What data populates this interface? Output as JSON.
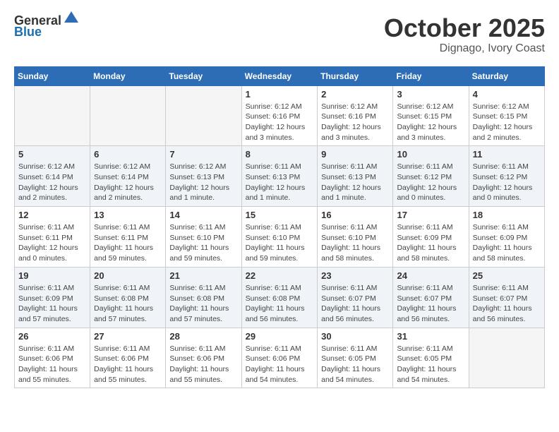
{
  "logo": {
    "general": "General",
    "blue": "Blue"
  },
  "title": "October 2025",
  "location": "Dignago, Ivory Coast",
  "weekdays": [
    "Sunday",
    "Monday",
    "Tuesday",
    "Wednesday",
    "Thursday",
    "Friday",
    "Saturday"
  ],
  "weeks": [
    [
      {
        "day": "",
        "info": ""
      },
      {
        "day": "",
        "info": ""
      },
      {
        "day": "",
        "info": ""
      },
      {
        "day": "1",
        "info": "Sunrise: 6:12 AM\nSunset: 6:16 PM\nDaylight: 12 hours\nand 3 minutes."
      },
      {
        "day": "2",
        "info": "Sunrise: 6:12 AM\nSunset: 6:16 PM\nDaylight: 12 hours\nand 3 minutes."
      },
      {
        "day": "3",
        "info": "Sunrise: 6:12 AM\nSunset: 6:15 PM\nDaylight: 12 hours\nand 3 minutes."
      },
      {
        "day": "4",
        "info": "Sunrise: 6:12 AM\nSunset: 6:15 PM\nDaylight: 12 hours\nand 2 minutes."
      }
    ],
    [
      {
        "day": "5",
        "info": "Sunrise: 6:12 AM\nSunset: 6:14 PM\nDaylight: 12 hours\nand 2 minutes."
      },
      {
        "day": "6",
        "info": "Sunrise: 6:12 AM\nSunset: 6:14 PM\nDaylight: 12 hours\nand 2 minutes."
      },
      {
        "day": "7",
        "info": "Sunrise: 6:12 AM\nSunset: 6:13 PM\nDaylight: 12 hours\nand 1 minute."
      },
      {
        "day": "8",
        "info": "Sunrise: 6:11 AM\nSunset: 6:13 PM\nDaylight: 12 hours\nand 1 minute."
      },
      {
        "day": "9",
        "info": "Sunrise: 6:11 AM\nSunset: 6:13 PM\nDaylight: 12 hours\nand 1 minute."
      },
      {
        "day": "10",
        "info": "Sunrise: 6:11 AM\nSunset: 6:12 PM\nDaylight: 12 hours\nand 0 minutes."
      },
      {
        "day": "11",
        "info": "Sunrise: 6:11 AM\nSunset: 6:12 PM\nDaylight: 12 hours\nand 0 minutes."
      }
    ],
    [
      {
        "day": "12",
        "info": "Sunrise: 6:11 AM\nSunset: 6:11 PM\nDaylight: 12 hours\nand 0 minutes."
      },
      {
        "day": "13",
        "info": "Sunrise: 6:11 AM\nSunset: 6:11 PM\nDaylight: 11 hours\nand 59 minutes."
      },
      {
        "day": "14",
        "info": "Sunrise: 6:11 AM\nSunset: 6:10 PM\nDaylight: 11 hours\nand 59 minutes."
      },
      {
        "day": "15",
        "info": "Sunrise: 6:11 AM\nSunset: 6:10 PM\nDaylight: 11 hours\nand 59 minutes."
      },
      {
        "day": "16",
        "info": "Sunrise: 6:11 AM\nSunset: 6:10 PM\nDaylight: 11 hours\nand 58 minutes."
      },
      {
        "day": "17",
        "info": "Sunrise: 6:11 AM\nSunset: 6:09 PM\nDaylight: 11 hours\nand 58 minutes."
      },
      {
        "day": "18",
        "info": "Sunrise: 6:11 AM\nSunset: 6:09 PM\nDaylight: 11 hours\nand 58 minutes."
      }
    ],
    [
      {
        "day": "19",
        "info": "Sunrise: 6:11 AM\nSunset: 6:09 PM\nDaylight: 11 hours\nand 57 minutes."
      },
      {
        "day": "20",
        "info": "Sunrise: 6:11 AM\nSunset: 6:08 PM\nDaylight: 11 hours\nand 57 minutes."
      },
      {
        "day": "21",
        "info": "Sunrise: 6:11 AM\nSunset: 6:08 PM\nDaylight: 11 hours\nand 57 minutes."
      },
      {
        "day": "22",
        "info": "Sunrise: 6:11 AM\nSunset: 6:08 PM\nDaylight: 11 hours\nand 56 minutes."
      },
      {
        "day": "23",
        "info": "Sunrise: 6:11 AM\nSunset: 6:07 PM\nDaylight: 11 hours\nand 56 minutes."
      },
      {
        "day": "24",
        "info": "Sunrise: 6:11 AM\nSunset: 6:07 PM\nDaylight: 11 hours\nand 56 minutes."
      },
      {
        "day": "25",
        "info": "Sunrise: 6:11 AM\nSunset: 6:07 PM\nDaylight: 11 hours\nand 56 minutes."
      }
    ],
    [
      {
        "day": "26",
        "info": "Sunrise: 6:11 AM\nSunset: 6:06 PM\nDaylight: 11 hours\nand 55 minutes."
      },
      {
        "day": "27",
        "info": "Sunrise: 6:11 AM\nSunset: 6:06 PM\nDaylight: 11 hours\nand 55 minutes."
      },
      {
        "day": "28",
        "info": "Sunrise: 6:11 AM\nSunset: 6:06 PM\nDaylight: 11 hours\nand 55 minutes."
      },
      {
        "day": "29",
        "info": "Sunrise: 6:11 AM\nSunset: 6:06 PM\nDaylight: 11 hours\nand 54 minutes."
      },
      {
        "day": "30",
        "info": "Sunrise: 6:11 AM\nSunset: 6:05 PM\nDaylight: 11 hours\nand 54 minutes."
      },
      {
        "day": "31",
        "info": "Sunrise: 6:11 AM\nSunset: 6:05 PM\nDaylight: 11 hours\nand 54 minutes."
      },
      {
        "day": "",
        "info": ""
      }
    ]
  ]
}
